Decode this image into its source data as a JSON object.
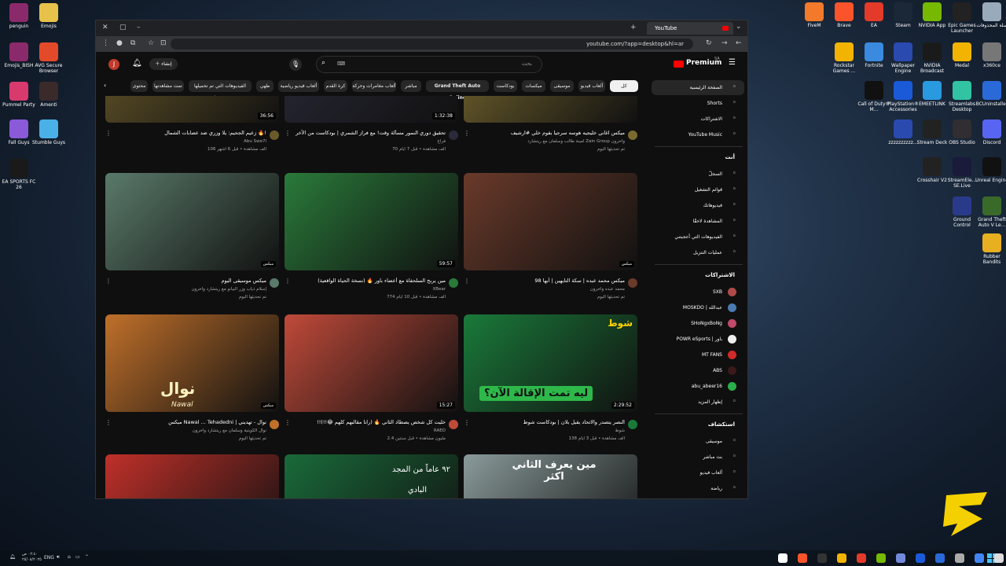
{
  "desktop_left": [
    {
      "label": "penguin",
      "icon": "winrar-icon",
      "color": "#8b2a6b"
    },
    {
      "label": "Emojis",
      "icon": "folder-icon",
      "color": "#e7c24a"
    },
    {
      "label": "Emojis_BISH",
      "icon": "winrar-icon",
      "color": "#8b2a6b"
    },
    {
      "label": "AVG Secure Browser",
      "icon": "avg-icon",
      "color": "#e34a2a"
    },
    {
      "label": "Pummel Party",
      "icon": "pummel-party-icon",
      "color": "#d83a6d"
    },
    {
      "label": "Amenti",
      "icon": "amenti-icon",
      "color": "#3a2a2a"
    },
    {
      "label": "Fall Guys",
      "icon": "fall-guys-icon",
      "color": "#8a5ad8"
    },
    {
      "label": "Stumble Guys",
      "icon": "stumble-guys-icon",
      "color": "#4ab0e8"
    },
    {
      "label": "EA SPORTS FC 26",
      "icon": "ea-fc-icon",
      "color": "#1a1a1a"
    }
  ],
  "desktop_right": [
    {
      "label": "FiveM",
      "icon": "fivem-icon",
      "color": "#f27a2a"
    },
    {
      "label": "Brave",
      "icon": "brave-icon",
      "color": "#fb542b"
    },
    {
      "label": "EA",
      "icon": "ea-icon",
      "color": "#e33a2a"
    },
    {
      "label": "Steam",
      "icon": "steam-icon",
      "color": "#1b2838"
    },
    {
      "label": "NVIDIA App",
      "icon": "nvidia-icon",
      "color": "#76b900"
    },
    {
      "label": "Epic Games Launcher",
      "icon": "epic-icon",
      "color": "#222"
    },
    {
      "label": "سلة المحذوفات",
      "icon": "recycle-bin-icon",
      "color": "#9ab"
    },
    {
      "label": "Rockstar Games ...",
      "icon": "rockstar-icon",
      "color": "#f2b400"
    },
    {
      "label": "Fortnite",
      "icon": "fortnite-icon",
      "color": "#3a8ae0"
    },
    {
      "label": "Wallpaper Engine",
      "icon": "wallpaper-engine-icon",
      "color": "#2a4ab0"
    },
    {
      "label": "NVIDIA Broadcast",
      "icon": "nvidia-broadcast-icon",
      "color": "#1a1a1a"
    },
    {
      "label": "Medal",
      "icon": "medal-icon",
      "color": "#f2b400"
    },
    {
      "label": "x360ce",
      "icon": "gamepad-icon",
      "color": "#777"
    },
    {
      "label": "Call of Duty® M...",
      "icon": "cod-icon",
      "color": "#111"
    },
    {
      "label": "PlayStation® Accessories",
      "icon": "playstation-icon",
      "color": "#1a5ad8"
    },
    {
      "label": "EMEETLINK",
      "icon": "emeet-icon",
      "color": "#2a9ae0"
    },
    {
      "label": "Streamlabs Desktop",
      "icon": "streamlabs-icon",
      "color": "#31c3a2"
    },
    {
      "label": "BCUninstaller",
      "icon": "uninstaller-icon",
      "color": "#2a6ad8"
    },
    {
      "label": "zzzzzzzzzz...",
      "icon": "iptv-icon",
      "color": "#2a4ab0"
    },
    {
      "label": "Stream Deck",
      "icon": "stream-deck-icon",
      "color": "#222"
    },
    {
      "label": "OBS Studio",
      "icon": "obs-icon",
      "color": "#302e31"
    },
    {
      "label": "Discord",
      "icon": "discord-icon",
      "color": "#5865f2"
    },
    {
      "label": "Crosshair V2",
      "icon": "crosshair-icon",
      "color": "#222"
    },
    {
      "label": "StreamEle... SE.Live",
      "icon": "streamelements-icon",
      "color": "#1a1a3a"
    },
    {
      "label": "Unreal Engine",
      "icon": "unreal-icon",
      "color": "#111"
    },
    {
      "label": "Ground Control",
      "icon": "ground-control-icon",
      "color": "#2a3a8a"
    },
    {
      "label": "Grand Theft Auto V Le...",
      "icon": "gta-icon",
      "color": "#3a6a2a"
    },
    {
      "label": "Rubber Bandits",
      "icon": "rubber-bandits-icon",
      "color": "#e8b020"
    }
  ],
  "browser": {
    "tab_title": "YouTube",
    "url": "youtube.com/?app=desktop&hl=ar"
  },
  "youtube": {
    "logo": "Premium",
    "logo_region": "SA",
    "create_label": "إنشاء",
    "avatar_letter": "J",
    "search_placeholder": "بحث"
  },
  "chips": [
    {
      "label": "كل الفيديوهات",
      "active": true
    },
    {
      "label": "ألعاب فيديو"
    },
    {
      "label": "موسيقى"
    },
    {
      "label": "ميكسات"
    },
    {
      "label": "بودكاست"
    },
    {
      "label": "Grand Theft Auto Online",
      "bold": true
    },
    {
      "label": "مباشر"
    },
    {
      "label": "ألعاب مغامرات وحركة"
    },
    {
      "label": "كرة القدم"
    },
    {
      "label": "ألعاب فيديو رياضية"
    },
    {
      "label": "طهي"
    },
    {
      "label": "الفيديوهات التي تم تحميلها مؤخرًا"
    },
    {
      "label": "تمت مشاهدتها"
    },
    {
      "label": "محتوى"
    }
  ],
  "sidebar": {
    "main": [
      {
        "label": "الصفحة الرئيسية",
        "icon": "home-icon",
        "active": true
      },
      {
        "label": "Shorts",
        "icon": "shorts-icon"
      },
      {
        "label": "الاشتراكات",
        "icon": "subscriptions-icon"
      },
      {
        "label": "YouTube Music",
        "icon": "youtube-music-icon"
      }
    ],
    "you_header": "أنت",
    "you": [
      {
        "label": "السجلّ",
        "icon": "history-icon"
      },
      {
        "label": "قوائم التشغيل",
        "icon": "playlists-icon"
      },
      {
        "label": "فيديوهاتك",
        "icon": "your-videos-icon"
      },
      {
        "label": "المشاهدة لاحقًا",
        "icon": "watch-later-icon"
      },
      {
        "label": "الفيديوهات التي أعجبتني",
        "icon": "liked-icon"
      },
      {
        "label": "عمليات التنزيل",
        "icon": "download-icon"
      }
    ],
    "subs_header": "الاشتراكات",
    "subs": [
      {
        "label": "SXB",
        "color": "#b04a4a"
      },
      {
        "label": "MOSKDO | عبدالله",
        "color": "#4a7ab0"
      },
      {
        "label": "SHoNgxBoNg",
        "color": "#c04a6a"
      },
      {
        "label": "POWR eSports | باور",
        "color": "#eee"
      },
      {
        "label": "MT FANS",
        "color": "#d02a2a"
      },
      {
        "label": "ABS",
        "color": "#3a1a1a"
      },
      {
        "label": "abu_abeer16",
        "color": "#2ab04a"
      },
      {
        "label": "إظهار المزيد",
        "icon": "chevron-down-icon"
      }
    ],
    "explore_header": "استكشاف",
    "explore": [
      {
        "label": "موسيقى",
        "icon": "music-icon"
      },
      {
        "label": "بث مباشر",
        "icon": "live-icon"
      },
      {
        "label": "ألعاب فيديو",
        "icon": "gaming-icon"
      },
      {
        "label": "رياضة",
        "icon": "sports-icon"
      }
    ]
  },
  "videos": [
    {
      "title": "ميكس اغاني خليجيه هوسه سرجيا بقوم خلي #ارشيف",
      "channel": "أمينة طالب وسلمان مع ريتشارد Zain Group وآخرون",
      "meta": "تم تحديثها اليوم",
      "duration": "",
      "mix": "",
      "thumb": "#7a6a30"
    },
    {
      "title": "تحقيق دوري النمور مسألة وقت! مع فراز الشمري | بودكاست من الآخر",
      "channel": "فراغ",
      "meta": "70 ألف مشاهدة • قبل 7 أيام",
      "duration": "1:32:38",
      "mix": "",
      "thumb": "#2a2a3a"
    },
    {
      "title": "زعيم الجحيم: يلا وزري ضد عصابات الشمال 🔥!",
      "channel": "Abu Swe7l",
      "meta": "106 ألف مشاهدة • قبل 6 أشهر",
      "duration": "36:56",
      "mix": "",
      "thumb": "#6a5a2a"
    },
    {
      "title": "ميكس محمد عبده | سكة التايهين | أبها 98",
      "channel": "محمد عبده وآخرون",
      "meta": "تم تحديثها اليوم",
      "duration": "",
      "mix": "ميكس",
      "thumb": "#6a3a2a"
    },
    {
      "title": "مين يربح السلحفاة مع أعضاء باور 🔥 (نسخة الحياة الواقعية)",
      "channel": "XBear",
      "meta": "774 ألف مشاهدة • قبل 10 أيام",
      "duration": "59:57",
      "mix": "",
      "thumb": "#2a7a3a"
    },
    {
      "title": "ميكس موسيقى اليوم",
      "channel": "إسلام ذياب وزر البيانو مع ريتشارد وآخرون",
      "meta": "تم تحديثها اليوم",
      "duration": "",
      "mix": "ميكس",
      "thumb": "#5a7a6a"
    },
    {
      "title": "النصر يتصدر والاتحاد يقيل بلان | بودكاست شوط",
      "channel": "شوط",
      "meta": "138 ألف مشاهدة • قبل 3 أيام",
      "duration": "2:29:52",
      "mix": "",
      "thumb": "#1a7a3a"
    },
    {
      "title": "!!خليت كل شخص يصطاد الثاني 🔥 (رانا مقالبهم كلهم 😂!!)",
      "channel": "RAED",
      "meta": "2.4 مليون مشاهدة • قبل سنتين",
      "duration": "15:27",
      "mix": "",
      "thumb": "#c04a3a"
    },
    {
      "title": "ميكس Nawal ... Tehadedni | نوال - تهديني",
      "channel": "نوال الكويتية وسلمان مع ريتشارد وآخرون",
      "meta": "تم تحديثها اليوم",
      "duration": "",
      "mix": "ميكس",
      "thumb": "#c0702a"
    },
    {
      "title": "",
      "channel": "",
      "meta": "",
      "duration": "",
      "mix": "",
      "thumb": "#8a9a9a"
    },
    {
      "title": "",
      "channel": "",
      "meta": "",
      "duration": "",
      "mix": "",
      "thumb": "#1a6a3a"
    },
    {
      "title": "",
      "channel": "",
      "meta": "",
      "duration": "",
      "mix": "",
      "thumb": "#c0302a"
    }
  ],
  "thumb_texts": {
    "v7": "ليه تمت الإقالة الآن؟",
    "v8": "شوط",
    "v9": "نوال",
    "v9b": "Nawal",
    "v10": "مين يعرف الثاني اكثر",
    "v11a": "٩٢ عاماً من المجد",
    "v11b": "البادي"
  },
  "taskbar": {
    "date_line1": "٠٢:٤٠ ص",
    "date_line2": "٢٥/٠٨/٢٠٢٥",
    "lang": "ENG"
  }
}
